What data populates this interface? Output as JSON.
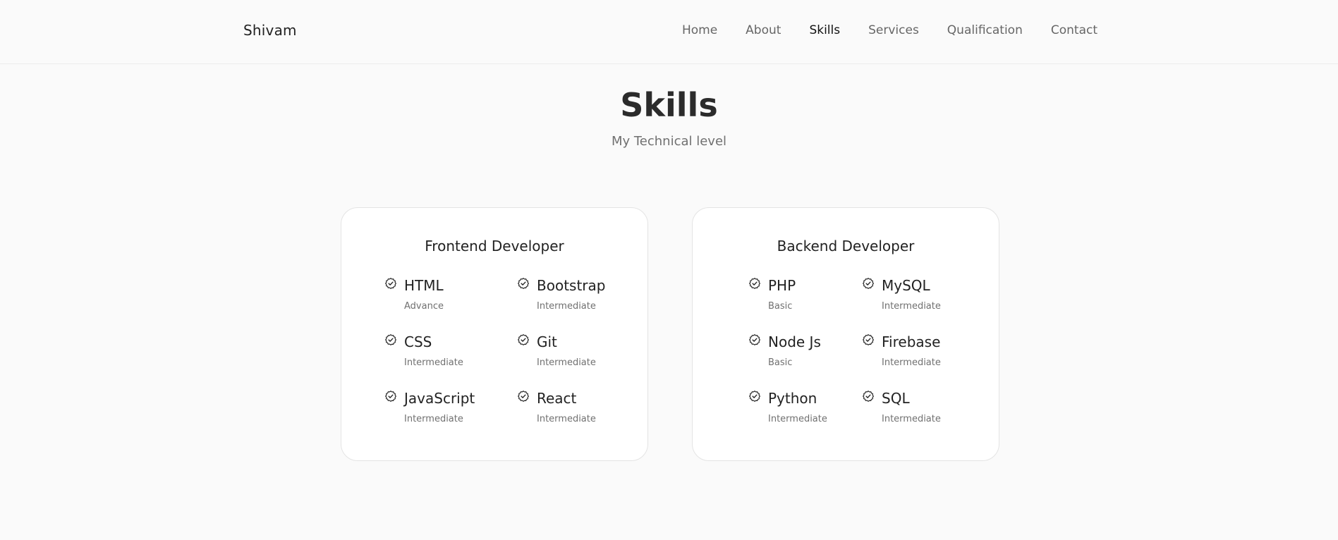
{
  "header": {
    "logo": "Shivam",
    "nav": [
      "Home",
      "About",
      "Skills",
      "Services",
      "Qualification",
      "Contact"
    ],
    "active": "Skills"
  },
  "section": {
    "title": "Skills",
    "subtitle": "My Technical level"
  },
  "cards": [
    {
      "title": "Frontend Developer",
      "skills": [
        {
          "name": "HTML",
          "level": "Advance"
        },
        {
          "name": "Bootstrap",
          "level": "Intermediate"
        },
        {
          "name": "CSS",
          "level": "Intermediate"
        },
        {
          "name": "Git",
          "level": "Intermediate"
        },
        {
          "name": "JavaScript",
          "level": "Intermediate"
        },
        {
          "name": "React",
          "level": "Intermediate"
        }
      ]
    },
    {
      "title": "Backend Developer",
      "skills": [
        {
          "name": "PHP",
          "level": "Basic"
        },
        {
          "name": "MySQL",
          "level": "Intermediate"
        },
        {
          "name": "Node Js",
          "level": "Basic"
        },
        {
          "name": "Firebase",
          "level": "Intermediate"
        },
        {
          "name": "Python",
          "level": "Intermediate"
        },
        {
          "name": "SQL",
          "level": "Intermediate"
        }
      ]
    }
  ],
  "icons": {
    "skill": "badge-check-icon"
  },
  "colors": {
    "background": "#fafafa",
    "text": "#222222",
    "muted": "#707070"
  }
}
